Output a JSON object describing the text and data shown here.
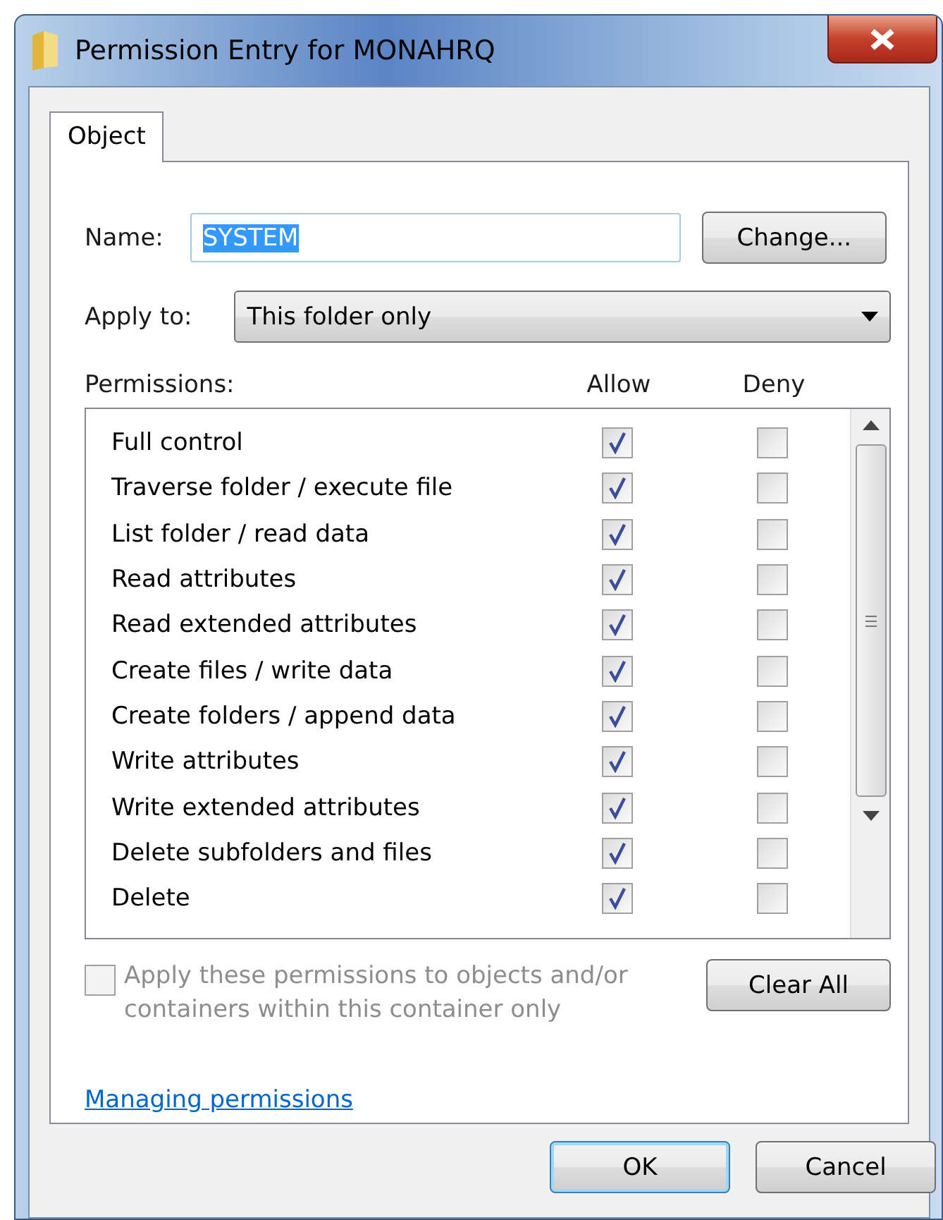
{
  "window": {
    "title": "Permission Entry for MONAHRQ"
  },
  "tabs": [
    {
      "label": "Object",
      "selected": true
    }
  ],
  "name_field": {
    "label": "Name:",
    "value": "SYSTEM",
    "text_selected": true
  },
  "change_button": "Change...",
  "apply_to": {
    "label": "Apply to:",
    "value": "This folder only"
  },
  "permissions": {
    "label": "Permissions:",
    "columns": [
      "Allow",
      "Deny"
    ],
    "rows": [
      {
        "name": "Full control",
        "allow": true,
        "deny": false
      },
      {
        "name": "Traverse folder / execute file",
        "allow": true,
        "deny": false
      },
      {
        "name": "List folder / read data",
        "allow": true,
        "deny": false
      },
      {
        "name": "Read attributes",
        "allow": true,
        "deny": false
      },
      {
        "name": "Read extended attributes",
        "allow": true,
        "deny": false
      },
      {
        "name": "Create files / write data",
        "allow": true,
        "deny": false
      },
      {
        "name": "Create folders / append data",
        "allow": true,
        "deny": false
      },
      {
        "name": "Write attributes",
        "allow": true,
        "deny": false
      },
      {
        "name": "Write extended attributes",
        "allow": true,
        "deny": false
      },
      {
        "name": "Delete subfolders and files",
        "allow": true,
        "deny": false
      },
      {
        "name": "Delete",
        "allow": true,
        "deny": false
      }
    ]
  },
  "apply_within": {
    "label": "Apply these permissions to objects and/or containers within this container only",
    "checked": false,
    "disabled": true
  },
  "clear_all_button": "Clear All",
  "help_link": "Managing permissions",
  "buttons": [
    {
      "label": "OK",
      "default": true
    },
    {
      "label": "Cancel",
      "default": false
    }
  ]
}
